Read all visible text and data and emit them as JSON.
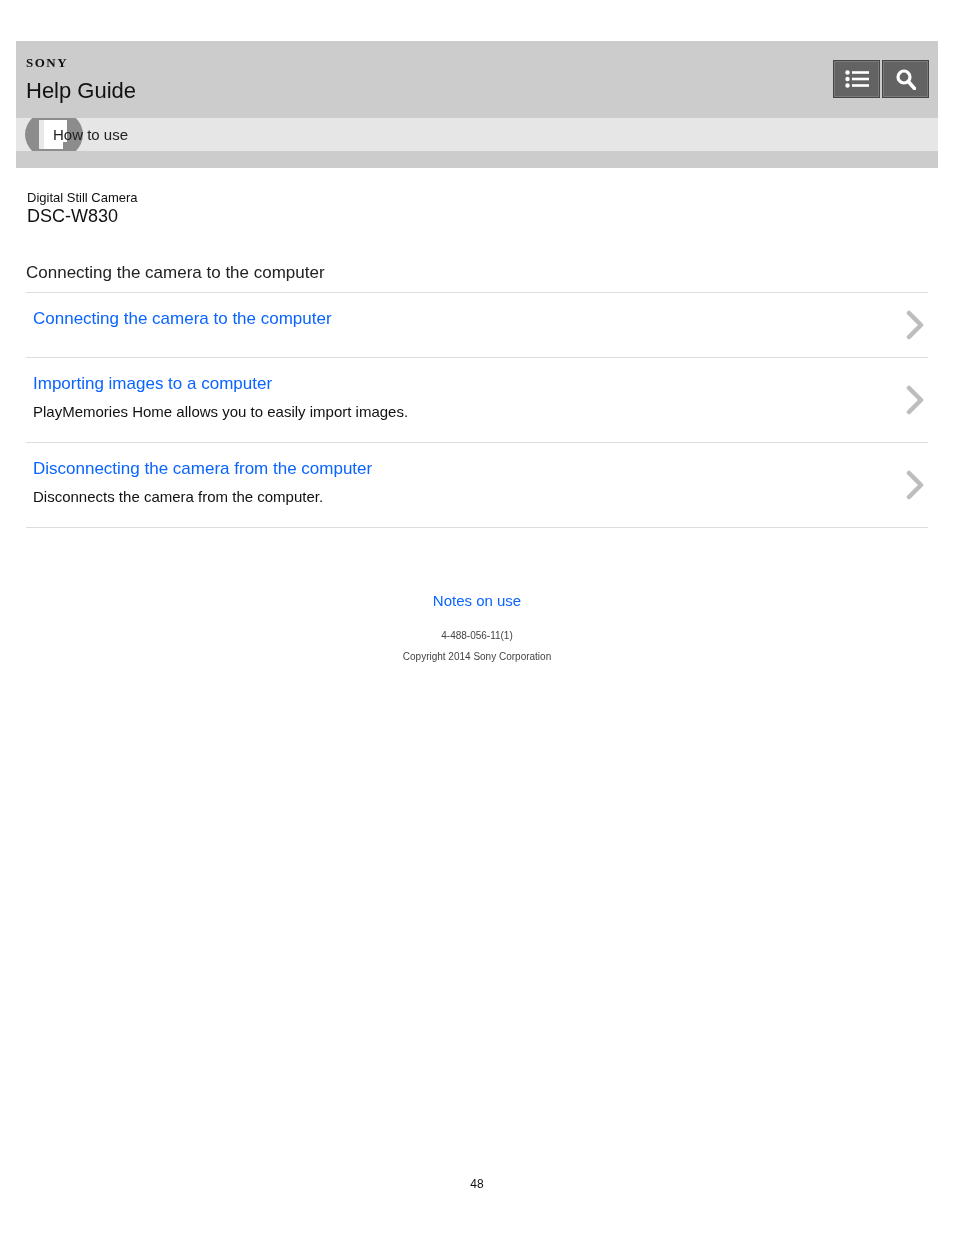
{
  "header": {
    "brand": "SONY",
    "title": "Help Guide",
    "buttons": [
      {
        "kind": "menu"
      },
      {
        "kind": "search"
      }
    ]
  },
  "breadcrumb": {
    "label": "How to use"
  },
  "product": {
    "category": "Digital Still Camera",
    "model": "DSC-W830"
  },
  "section": {
    "title": "Connecting the camera to the computer",
    "items": [
      {
        "title": "Connecting the camera to the computer"
      },
      {
        "title": "Importing images to a computer",
        "description": "PlayMemories Home allows you to easily import images."
      },
      {
        "title": "Disconnecting the camera from the computer",
        "description": "Disconnects the camera from the computer."
      }
    ]
  },
  "footer": {
    "link": "Notes on use",
    "code": "4-488-056-11(1)",
    "copyright": "Copyright 2014 Sony Corporation"
  },
  "page_number": "48"
}
